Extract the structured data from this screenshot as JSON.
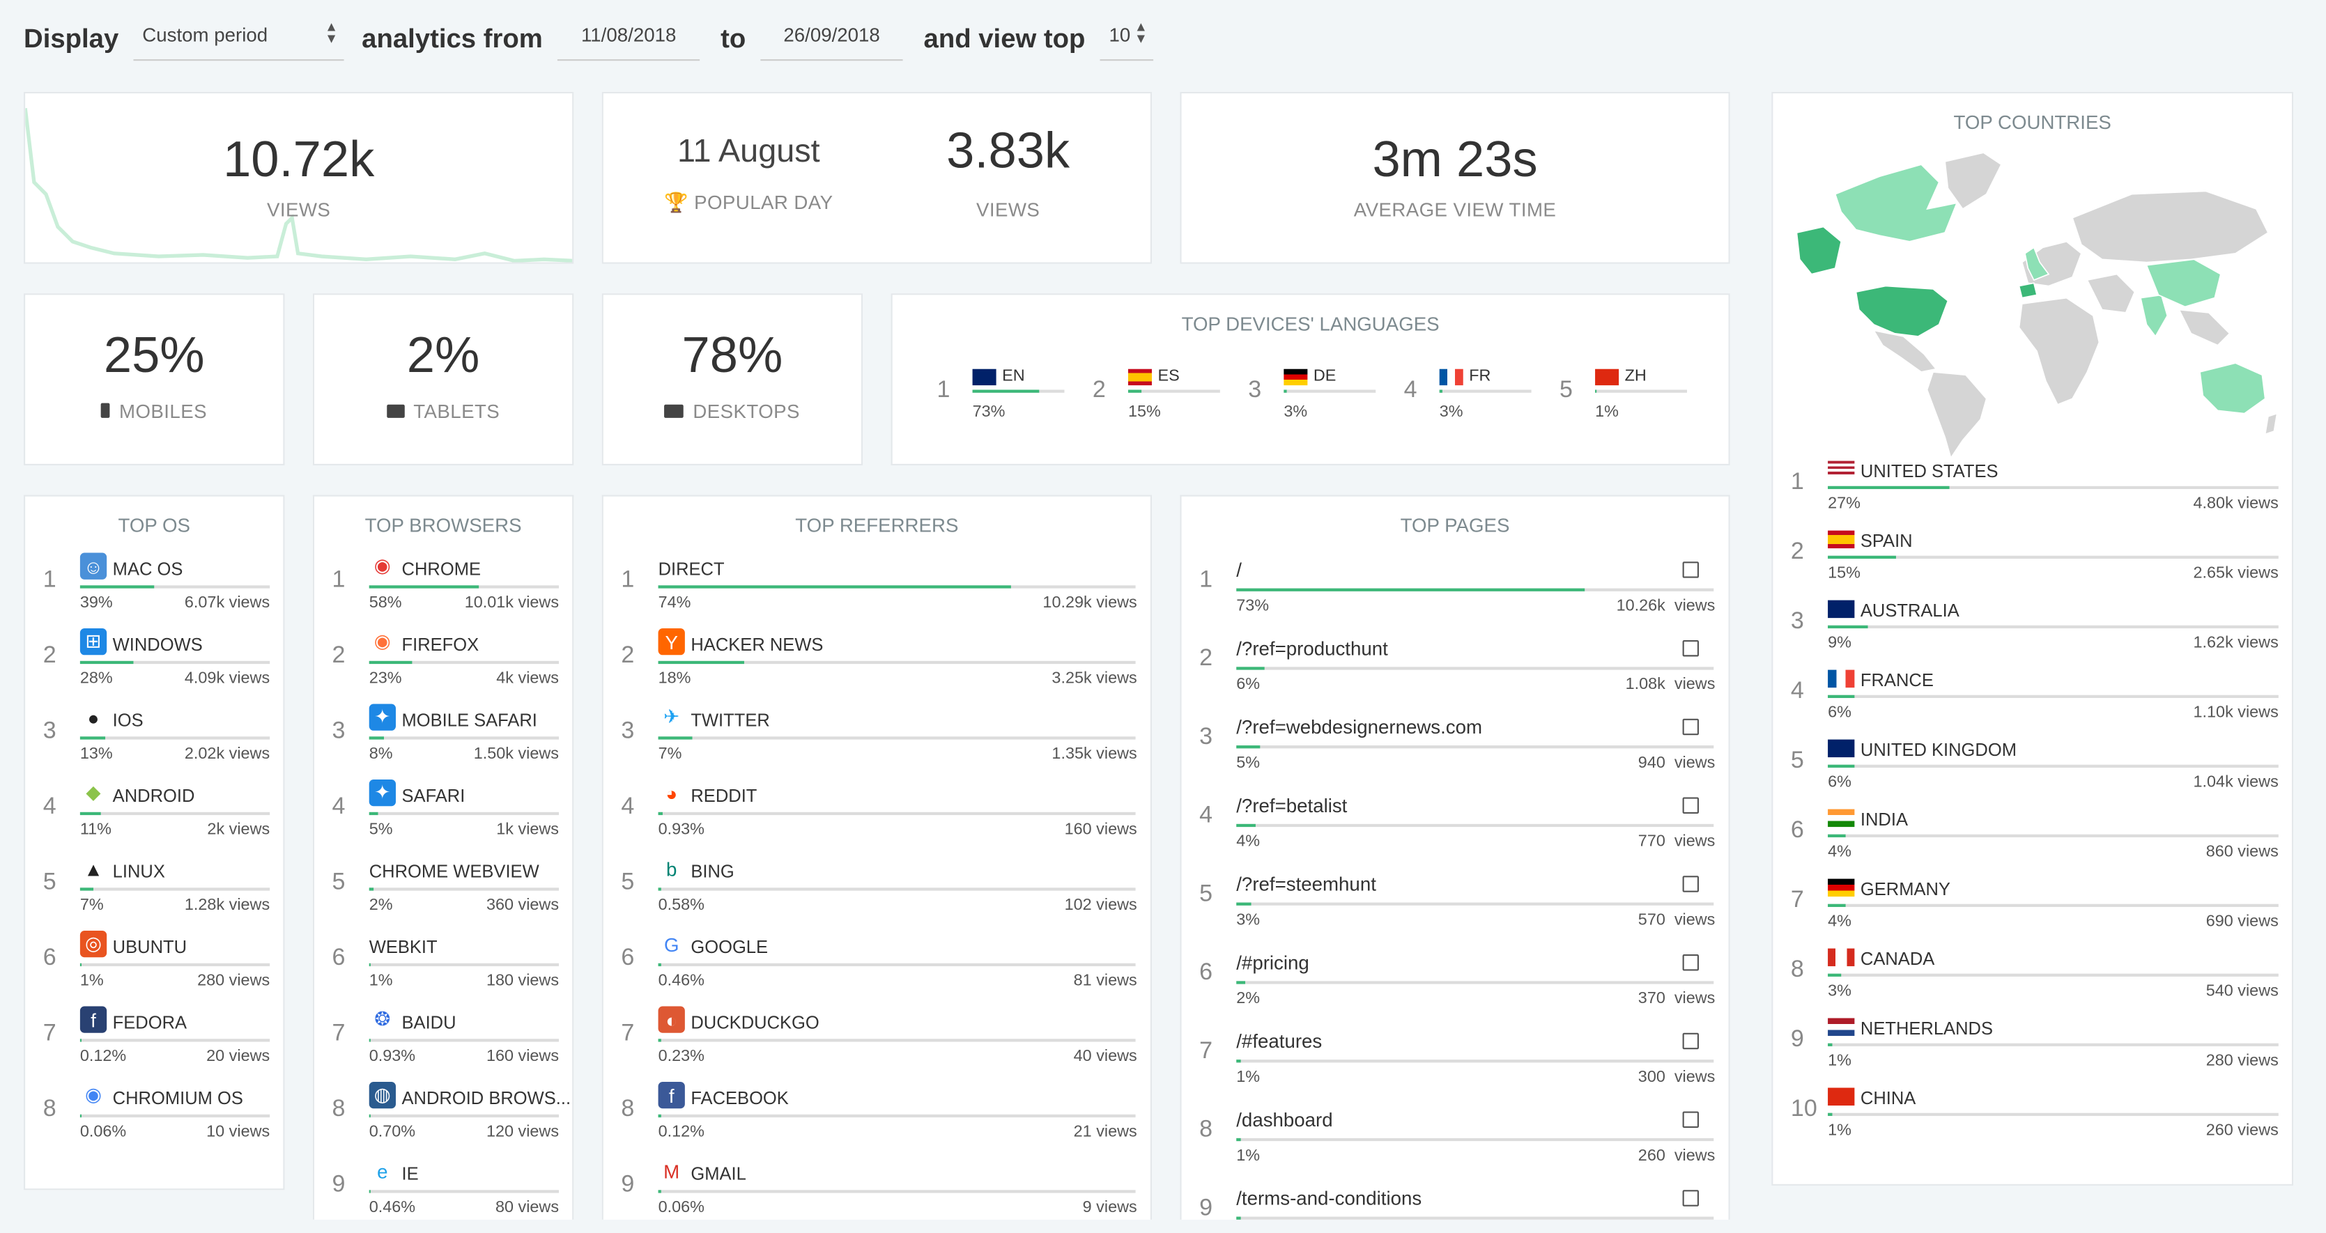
{
  "toolbar": {
    "display_label": "Display",
    "period_value": "Custom period",
    "analytics_label": "analytics from",
    "from_date": "11/08/2018",
    "to_label": "to",
    "to_date": "26/09/2018",
    "view_top_label": "and view top",
    "top_value": "10"
  },
  "views_card": {
    "value": "10.72k",
    "label": "VIEWS"
  },
  "popular_card": {
    "day": "11 August",
    "day_label": "POPULAR DAY",
    "views": "3.83k",
    "views_label": "VIEWS"
  },
  "avg_card": {
    "value": "3m 23s",
    "label": "AVERAGE VIEW TIME"
  },
  "mobiles": {
    "value": "25%",
    "label": "MOBILES"
  },
  "tablets": {
    "value": "2%",
    "label": "TABLETS"
  },
  "desktops": {
    "value": "78%",
    "label": "DESKTOPS"
  },
  "languages": {
    "title": "TOP DEVICES' LANGUAGES",
    "items": [
      {
        "rank": "1",
        "code": "EN",
        "pct": "73%",
        "fill": 0.73
      },
      {
        "rank": "2",
        "code": "ES",
        "pct": "15%",
        "fill": 0.15
      },
      {
        "rank": "3",
        "code": "DE",
        "pct": "3%",
        "fill": 0.03
      },
      {
        "rank": "4",
        "code": "FR",
        "pct": "3%",
        "fill": 0.03
      },
      {
        "rank": "5",
        "code": "ZH",
        "pct": "1%",
        "fill": 0.01
      }
    ]
  },
  "os": {
    "title": "TOP OS",
    "items": [
      {
        "rank": "1",
        "name": "MAC OS",
        "pct": "39%",
        "views": "6.07k views",
        "fill": 0.39,
        "icon": "mac-os-icon"
      },
      {
        "rank": "2",
        "name": "WINDOWS",
        "pct": "28%",
        "views": "4.09k views",
        "fill": 0.28,
        "icon": "windows-icon"
      },
      {
        "rank": "3",
        "name": "IOS",
        "pct": "13%",
        "views": "2.02k views",
        "fill": 0.13,
        "icon": "apple-icon"
      },
      {
        "rank": "4",
        "name": "ANDROID",
        "pct": "11%",
        "views": "2k views",
        "fill": 0.11,
        "icon": "android-icon"
      },
      {
        "rank": "5",
        "name": "LINUX",
        "pct": "7%",
        "views": "1.28k views",
        "fill": 0.07,
        "icon": "linux-icon"
      },
      {
        "rank": "6",
        "name": "UBUNTU",
        "pct": "1%",
        "views": "280 views",
        "fill": 0.01,
        "icon": "ubuntu-icon"
      },
      {
        "rank": "7",
        "name": "FEDORA",
        "pct": "0.12%",
        "views": "20 views",
        "fill": 0.0012,
        "icon": "fedora-icon"
      },
      {
        "rank": "8",
        "name": "CHROMIUM OS",
        "pct": "0.06%",
        "views": "10 views",
        "fill": 0.0006,
        "icon": "chromium-icon"
      }
    ]
  },
  "browsers": {
    "title": "TOP BROWSERS",
    "items": [
      {
        "rank": "1",
        "name": "CHROME",
        "pct": "58%",
        "views": "10.01k views",
        "fill": 0.58,
        "icon": "chrome-icon"
      },
      {
        "rank": "2",
        "name": "FIREFOX",
        "pct": "23%",
        "views": "4k views",
        "fill": 0.23,
        "icon": "firefox-icon"
      },
      {
        "rank": "3",
        "name": "MOBILE SAFARI",
        "pct": "8%",
        "views": "1.50k views",
        "fill": 0.08,
        "icon": "safari-icon"
      },
      {
        "rank": "4",
        "name": "SAFARI",
        "pct": "5%",
        "views": "1k views",
        "fill": 0.05,
        "icon": "safari-icon"
      },
      {
        "rank": "5",
        "name": "CHROME WEBVIEW",
        "pct": "2%",
        "views": "360 views",
        "fill": 0.02,
        "icon": ""
      },
      {
        "rank": "6",
        "name": "WEBKIT",
        "pct": "1%",
        "views": "180 views",
        "fill": 0.01,
        "icon": ""
      },
      {
        "rank": "7",
        "name": "BAIDU",
        "pct": "0.93%",
        "views": "160 views",
        "fill": 0.0093,
        "icon": "baidu-icon"
      },
      {
        "rank": "8",
        "name": "ANDROID BROWS...",
        "pct": "0.70%",
        "views": "120 views",
        "fill": 0.007,
        "icon": "android-browser-icon"
      },
      {
        "rank": "9",
        "name": "IE",
        "pct": "0.46%",
        "views": "80 views",
        "fill": 0.0046,
        "icon": "ie-icon"
      }
    ]
  },
  "referrers": {
    "title": "TOP REFERRERS",
    "items": [
      {
        "rank": "1",
        "name": "DIRECT",
        "pct": "74%",
        "views": "10.29k views",
        "fill": 0.74,
        "icon": ""
      },
      {
        "rank": "2",
        "name": "HACKER NEWS",
        "pct": "18%",
        "views": "3.25k views",
        "fill": 0.18,
        "icon": "hacker-news-icon"
      },
      {
        "rank": "3",
        "name": "TWITTER",
        "pct": "7%",
        "views": "1.35k views",
        "fill": 0.07,
        "icon": "twitter-icon"
      },
      {
        "rank": "4",
        "name": "REDDIT",
        "pct": "0.93%",
        "views": "160 views",
        "fill": 0.0093,
        "icon": "reddit-icon"
      },
      {
        "rank": "5",
        "name": "BING",
        "pct": "0.58%",
        "views": "102 views",
        "fill": 0.0058,
        "icon": "bing-icon"
      },
      {
        "rank": "6",
        "name": "GOOGLE",
        "pct": "0.46%",
        "views": "81 views",
        "fill": 0.0046,
        "icon": "google-icon"
      },
      {
        "rank": "7",
        "name": "DUCKDUCKGO",
        "pct": "0.23%",
        "views": "40 views",
        "fill": 0.0023,
        "icon": "duckduckgo-icon"
      },
      {
        "rank": "8",
        "name": "FACEBOOK",
        "pct": "0.12%",
        "views": "21 views",
        "fill": 0.0012,
        "icon": "facebook-icon"
      },
      {
        "rank": "9",
        "name": "GMAIL",
        "pct": "0.06%",
        "views": "9 views",
        "fill": 0.0006,
        "icon": "gmail-icon"
      }
    ]
  },
  "pages": {
    "title": "TOP PAGES",
    "items": [
      {
        "rank": "1",
        "path": "/",
        "pct": "73%",
        "views": "10.26k  views",
        "fill": 0.73
      },
      {
        "rank": "2",
        "path": "/?ref=producthunt",
        "pct": "6%",
        "views": "1.08k  views",
        "fill": 0.06
      },
      {
        "rank": "3",
        "path": "/?ref=webdesignernews.com",
        "pct": "5%",
        "views": "940  views",
        "fill": 0.05
      },
      {
        "rank": "4",
        "path": "/?ref=betalist",
        "pct": "4%",
        "views": "770  views",
        "fill": 0.04
      },
      {
        "rank": "5",
        "path": "/?ref=steemhunt",
        "pct": "3%",
        "views": "570  views",
        "fill": 0.03
      },
      {
        "rank": "6",
        "path": "/#pricing",
        "pct": "2%",
        "views": "370  views",
        "fill": 0.02
      },
      {
        "rank": "7",
        "path": "/#features",
        "pct": "1%",
        "views": "300  views",
        "fill": 0.01
      },
      {
        "rank": "8",
        "path": "/dashboard",
        "pct": "1%",
        "views": "260  views",
        "fill": 0.01
      },
      {
        "rank": "9",
        "path": "/terms-and-conditions",
        "pct": "",
        "views": "",
        "fill": 0.01
      }
    ]
  },
  "countries": {
    "title": "TOP COUNTRIES",
    "items": [
      {
        "rank": "1",
        "name": "UNITED STATES",
        "pct": "27%",
        "views": "4.80k views",
        "fill": 0.27
      },
      {
        "rank": "2",
        "name": "SPAIN",
        "pct": "15%",
        "views": "2.65k views",
        "fill": 0.15
      },
      {
        "rank": "3",
        "name": "AUSTRALIA",
        "pct": "9%",
        "views": "1.62k views",
        "fill": 0.09
      },
      {
        "rank": "4",
        "name": "FRANCE",
        "pct": "6%",
        "views": "1.10k views",
        "fill": 0.06
      },
      {
        "rank": "5",
        "name": "UNITED KINGDOM",
        "pct": "6%",
        "views": "1.04k views",
        "fill": 0.06
      },
      {
        "rank": "6",
        "name": "INDIA",
        "pct": "4%",
        "views": "860 views",
        "fill": 0.04
      },
      {
        "rank": "7",
        "name": "GERMANY",
        "pct": "4%",
        "views": "690 views",
        "fill": 0.04
      },
      {
        "rank": "8",
        "name": "CANADA",
        "pct": "3%",
        "views": "540 views",
        "fill": 0.03
      },
      {
        "rank": "9",
        "name": "NETHERLANDS",
        "pct": "1%",
        "views": "280 views",
        "fill": 0.01
      },
      {
        "rank": "10",
        "name": "CHINA",
        "pct": "1%",
        "views": "260 views",
        "fill": 0.01
      }
    ]
  },
  "colors": {
    "accent": "#3cb878",
    "map_high": "#3cb878",
    "map_mid": "#8de0b5",
    "map_low": "#d5d5d5"
  }
}
